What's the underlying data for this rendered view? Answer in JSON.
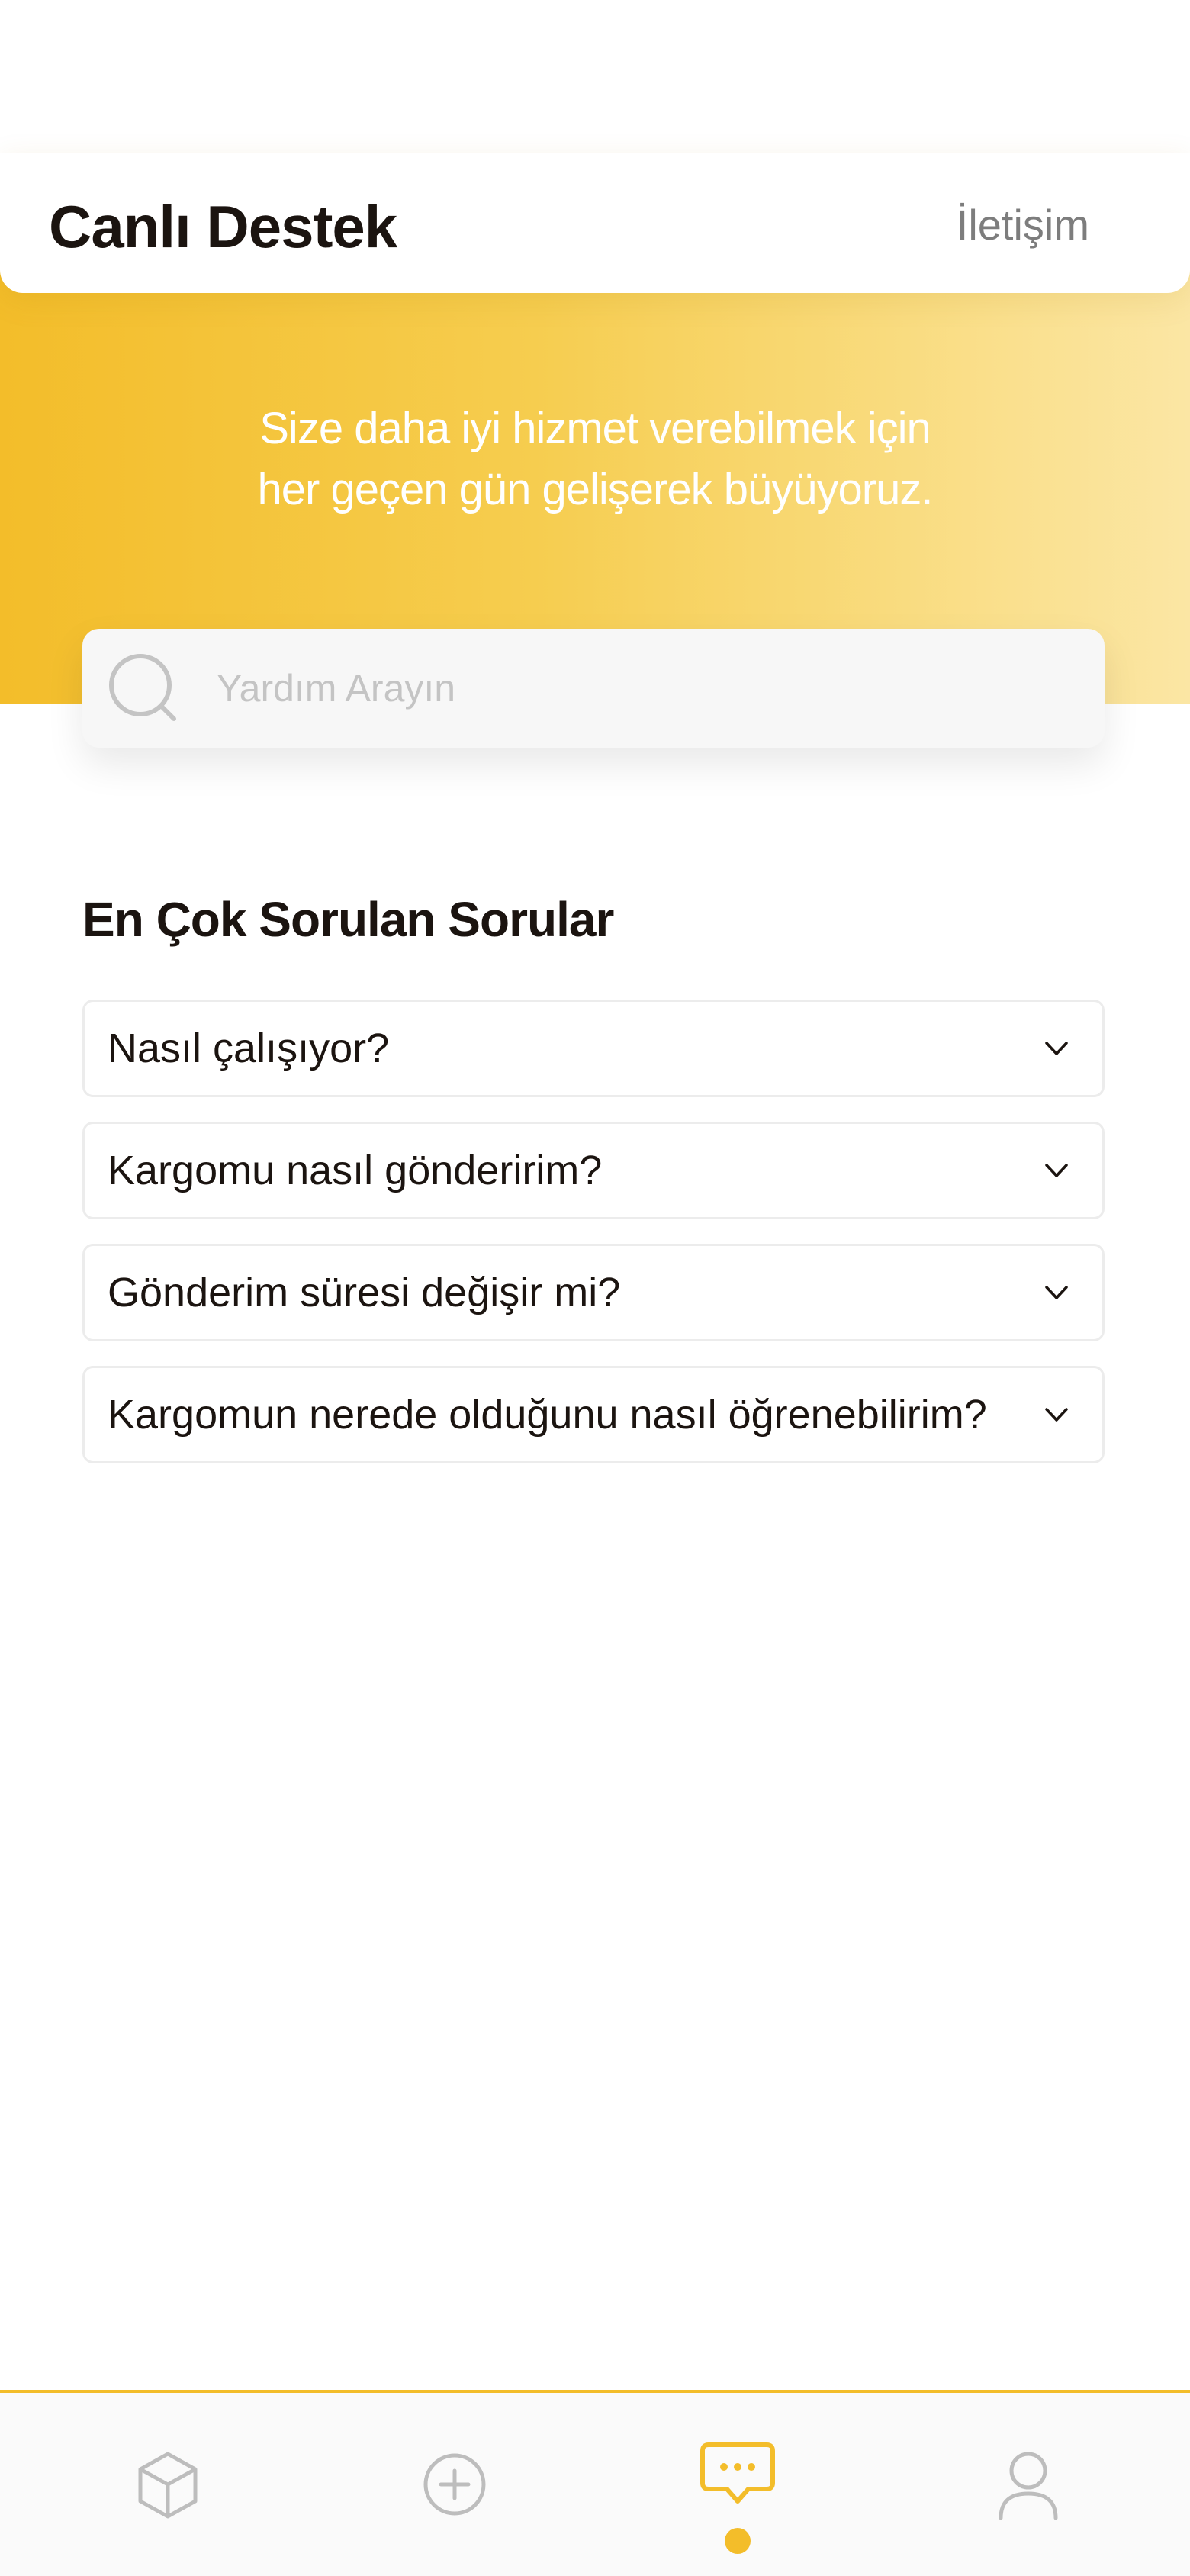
{
  "header": {
    "title": "Canlı Destek",
    "contact_link": "İletişim"
  },
  "hero": {
    "tagline_line1": "Size daha iyi hizmet verebilmek için",
    "tagline_line2": "her geçen gün gelişerek büyüyoruz."
  },
  "search": {
    "placeholder": "Yardım Arayın",
    "value": "",
    "icon": "search-icon"
  },
  "faq": {
    "title": "En Çok Sorulan Sorular",
    "items": [
      {
        "question": "Nasıl çalışıyor?"
      },
      {
        "question": "Kargomu nasıl gönderirim?"
      },
      {
        "question": "Gönderim süresi değişir mi?"
      },
      {
        "question": "Kargomun nerede olduğunu nasıl öğrenebilirim?"
      }
    ]
  },
  "tabbar": {
    "tabs": [
      {
        "icon": "package-icon",
        "active": false
      },
      {
        "icon": "add-circle-icon",
        "active": false
      },
      {
        "icon": "chat-icon",
        "active": true
      },
      {
        "icon": "profile-icon",
        "active": false
      }
    ]
  },
  "colors": {
    "accent": "#f3bd2a",
    "hero_gradient_end": "#fbe6a4",
    "text_dark": "#1b1410",
    "muted": "#7d7d7d"
  }
}
